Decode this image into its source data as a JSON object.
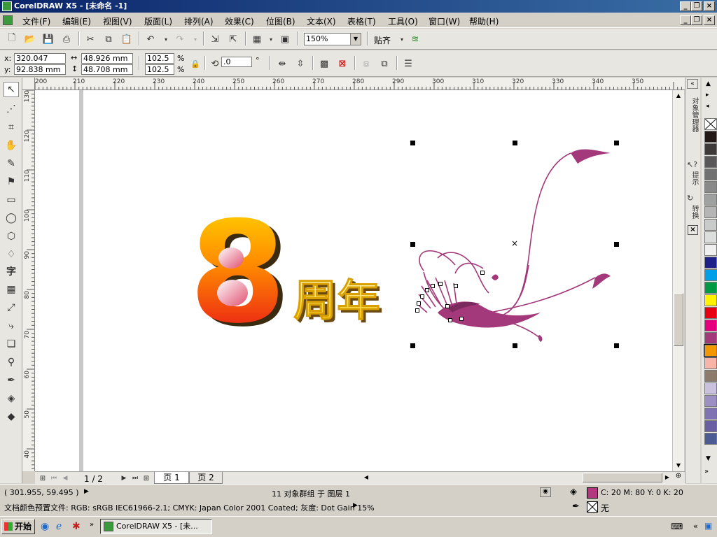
{
  "window": {
    "title": "CorelDRAW X5 - [未命名 -1]"
  },
  "menu": [
    "文件(F)",
    "编辑(E)",
    "视图(V)",
    "版面(L)",
    "排列(A)",
    "效果(C)",
    "位图(B)",
    "文本(X)",
    "表格(T)",
    "工具(O)",
    "窗口(W)",
    "帮助(H)"
  ],
  "toolbar": {
    "zoom": "150%",
    "snap_label": "贴齐"
  },
  "propbar": {
    "x_label": "x:",
    "x_value": "320.047 mm",
    "y_label": "y:",
    "y_value": "92.838 mm",
    "w_value": "48.926 mm",
    "h_value": "48.708 mm",
    "scale_x": "102.5",
    "scale_y": "102.5",
    "pct": "%",
    "rotation": ".0",
    "deg": "°"
  },
  "hruler": [
    "200",
    "210",
    "220",
    "230",
    "240",
    "250",
    "260",
    "270",
    "280",
    "290",
    "300",
    "310",
    "320",
    "330",
    "340",
    "350"
  ],
  "vruler": [
    "130",
    "120",
    "110",
    "100",
    "90",
    "80",
    "70",
    "60",
    "50",
    "40"
  ],
  "canvas": {
    "big_number": "8",
    "anniv_text": "周年"
  },
  "pages": {
    "counter": "1 / 2",
    "tab1": "页 1",
    "tab2": "页 2"
  },
  "dockers": {
    "tab1": "对象管理器",
    "tab2": "提示",
    "tab3": "转换"
  },
  "palette": [
    "#ffffff",
    "#231815",
    "#3e3a39",
    "#595757",
    "#727171",
    "#898989",
    "#9fa0a0",
    "#b5b5b6",
    "#c9caca",
    "#dcdddd",
    "#efefef",
    "#1d2088",
    "#00a0e9",
    "#009944",
    "#fff100",
    "#e60012",
    "#e4007f",
    "#a3387a",
    "#f39800",
    "#f8b4a8",
    "#8c7a6b",
    "#c9c1dd",
    "#9b8fc4",
    "#8073b3",
    "#6a5fa3",
    "#4c5b94"
  ],
  "status": {
    "coords": "( 301.955, 59.495 )",
    "selection": "11 对象群组 于 图层 1",
    "fill_values": "C: 20 M: 80 Y: 0 K: 20",
    "fill_color": "#b2397f",
    "outline_text": "无",
    "profile": "文档颜色预置文件: RGB: sRGB IEC61966-2.1; CMYK: Japan Color 2001 Coated; 灰度: Dot Gain 15%"
  },
  "taskbar": {
    "start": "开始",
    "task": "CorelDRAW X5 - [未..."
  }
}
